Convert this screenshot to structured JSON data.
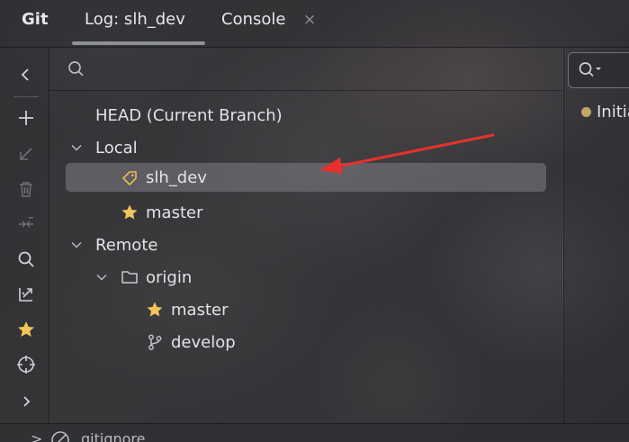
{
  "tabs": {
    "app": "Git",
    "log": "Log: slh_dev",
    "console": "Console",
    "close_glyph": "×"
  },
  "toolbar": {
    "icons": [
      "collapse-left-icon",
      "plus-icon",
      "checkout-arrow-icon",
      "trash-icon",
      "merge-icon",
      "search-icon",
      "compare-icon",
      "star-icon",
      "target-icon",
      "expand-right-icon"
    ]
  },
  "tree": {
    "head": "HEAD (Current Branch)",
    "local": "Local",
    "local_branches": [
      "slh_dev",
      "master"
    ],
    "remote": "Remote",
    "remote_origin": "origin",
    "remote_branches": [
      "master",
      "develop"
    ]
  },
  "right_pane": {
    "commit_text": "Initia"
  },
  "statusbar": {
    "breadcrumb_sep": ">",
    "file": "gitignore"
  },
  "colors": {
    "star": "#f2c55c",
    "tag": "#e9b85a",
    "arrow": "#e8312c",
    "selection": "#7d7d87"
  }
}
